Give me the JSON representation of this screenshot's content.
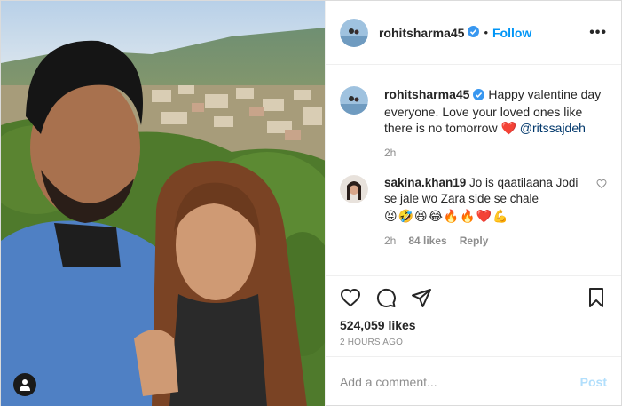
{
  "header": {
    "username": "rohitsharma45",
    "dot": "•",
    "follow_label": "Follow",
    "more_label": "•••"
  },
  "caption": {
    "username": "rohitsharma45",
    "text": "Happy valentine day everyone. Love your loved ones like there is no tomorrow",
    "emoji": "❤️",
    "mention": "@ritssajdeh",
    "time": "2h"
  },
  "comment": {
    "username": "sakina.khan19",
    "text": "Jo is qaatilaana Jodi se jale wo Zara side se chale",
    "emojis": "😝🤣😆😂🔥🔥❤️💪",
    "time": "2h",
    "likes": "84 likes",
    "reply_label": "Reply"
  },
  "actions": {
    "like_icon": "heart-icon",
    "comment_icon": "comment-icon",
    "share_icon": "share-icon",
    "save_icon": "bookmark-icon"
  },
  "likes": "524,059 likes",
  "posted": "2 HOURS AGO",
  "add_comment": {
    "placeholder": "Add a comment...",
    "post_label": "Post"
  },
  "colors": {
    "follow": "#0095f6",
    "verified": "#3897f0",
    "muted": "#8e8e8e",
    "heart_red": "#ed4956"
  }
}
